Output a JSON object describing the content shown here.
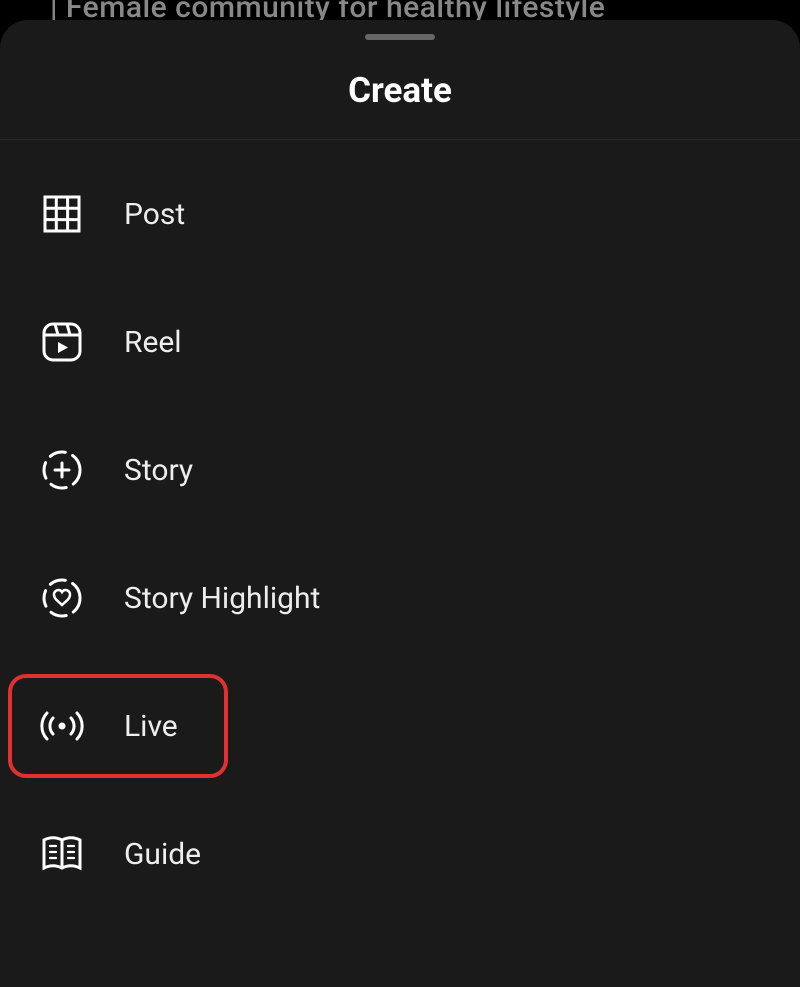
{
  "background": {
    "partial_text": "| Female community for healthy lifestyle"
  },
  "sheet": {
    "title": "Create",
    "items": [
      {
        "label": "Post",
        "icon": "grid-icon"
      },
      {
        "label": "Reel",
        "icon": "reel-icon"
      },
      {
        "label": "Story",
        "icon": "story-plus-icon"
      },
      {
        "label": "Story Highlight",
        "icon": "story-heart-icon"
      },
      {
        "label": "Live",
        "icon": "live-icon"
      },
      {
        "label": "Guide",
        "icon": "guide-icon"
      }
    ],
    "highlighted_index": 4
  },
  "colors": {
    "sheet_bg": "#1a1a1a",
    "text": "#eeeeee",
    "highlight": "#e03030"
  }
}
